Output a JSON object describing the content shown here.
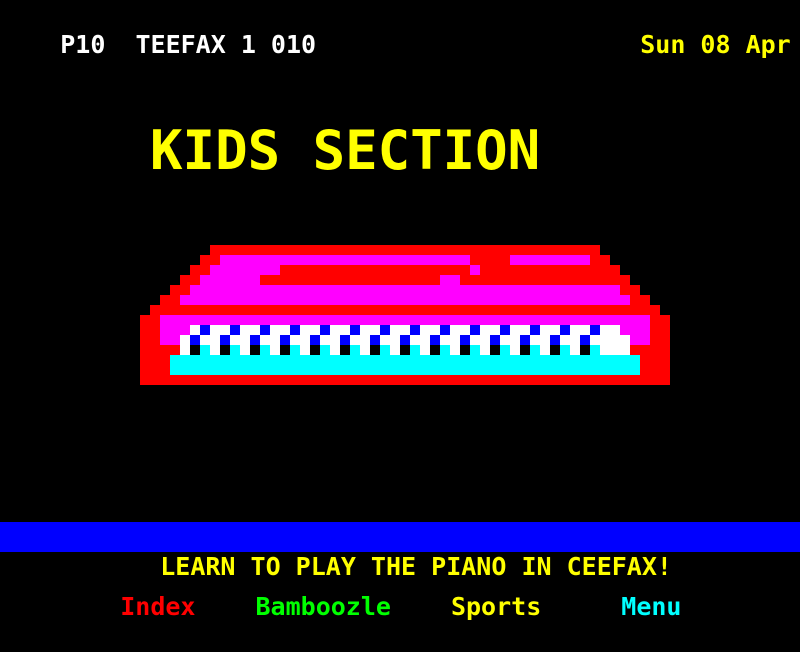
{
  "service": {
    "page_number": "P10",
    "service_name": "TEEFAX",
    "magazine": "1",
    "page_code": "010",
    "header_text": "P10  TEEFAX 1 010",
    "date": "Sun 08 Apr",
    "header_color": "#ffffff",
    "date_color": "#ffff00"
  },
  "title": {
    "text": "KIDS SECTION",
    "color": "#ffff00"
  },
  "graphic": {
    "name": "piano-keyboard",
    "description": "Electronic keyboard / piano drawn in teletext mosaic blocks",
    "colors": {
      "frame": "#ff0000",
      "body": "#ff00ff",
      "keys": "#ffffff",
      "black_keys": "#0000ff",
      "key_tips": "#000000",
      "front_panel": "#00ffff"
    }
  },
  "banner": {
    "text": "LEARN TO PLAY THE PIANO IN CEEFAX!",
    "text_color": "#ffff00",
    "background_color": "#0000ff"
  },
  "nav": {
    "items": [
      {
        "label": "Index",
        "color": "#ff0000"
      },
      {
        "label": "Bamboozle",
        "color": "#00ff00"
      },
      {
        "label": "Sports",
        "color": "#ffff00"
      },
      {
        "label": "Menu",
        "color": "#00ffff"
      }
    ]
  },
  "palette": {
    "background": "#000000",
    "white": "#ffffff",
    "yellow": "#ffff00",
    "red": "#ff0000",
    "green": "#00ff00",
    "cyan": "#00ffff",
    "magenta": "#ff00ff",
    "blue": "#0000ff"
  }
}
